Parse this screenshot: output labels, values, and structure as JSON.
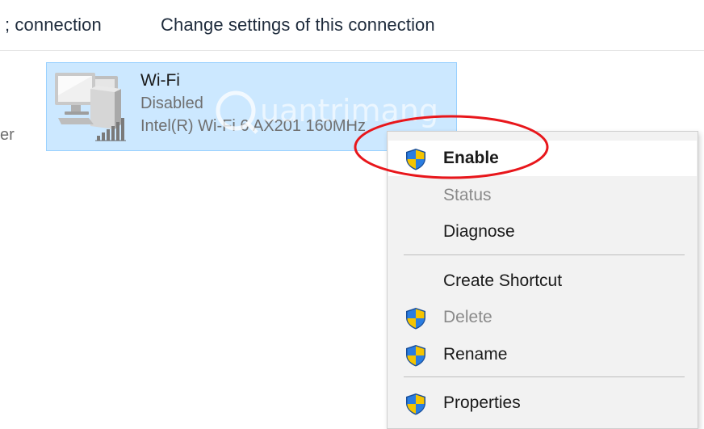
{
  "toolbar": {
    "item1": "; connection",
    "item2": "Change settings of this connection"
  },
  "left_fragment": "er",
  "connection": {
    "name": "Wi-Fi",
    "status": "Disabled",
    "device": "Intel(R) Wi-Fi 6 AX201 160MHz",
    "icon": "network-computer-wifi-icon"
  },
  "watermark": {
    "text": "uantrimang"
  },
  "context_menu": {
    "items": [
      {
        "label": "Enable",
        "icon": "uac-shield-icon",
        "state": "highlighted-bold"
      },
      {
        "label": "Status",
        "icon": "",
        "state": "disabled"
      },
      {
        "label": "Diagnose",
        "icon": "",
        "state": "normal"
      },
      {
        "label": "Create Shortcut",
        "icon": "",
        "state": "normal"
      },
      {
        "label": "Delete",
        "icon": "uac-shield-icon",
        "state": "disabled"
      },
      {
        "label": "Rename",
        "icon": "uac-shield-icon",
        "state": "normal"
      },
      {
        "label": "Properties",
        "icon": "uac-shield-icon",
        "state": "normal"
      }
    ]
  },
  "colors": {
    "tile_bg": "#cce8ff",
    "tile_border": "#99d1ff",
    "menu_bg": "#f2f2f2",
    "highlight_bg": "#ffffff",
    "disabled_text": "#8a8a8a",
    "annotation_red": "#e8161b",
    "shield_blue": "#1f6fd1",
    "shield_yellow": "#f5c400"
  }
}
